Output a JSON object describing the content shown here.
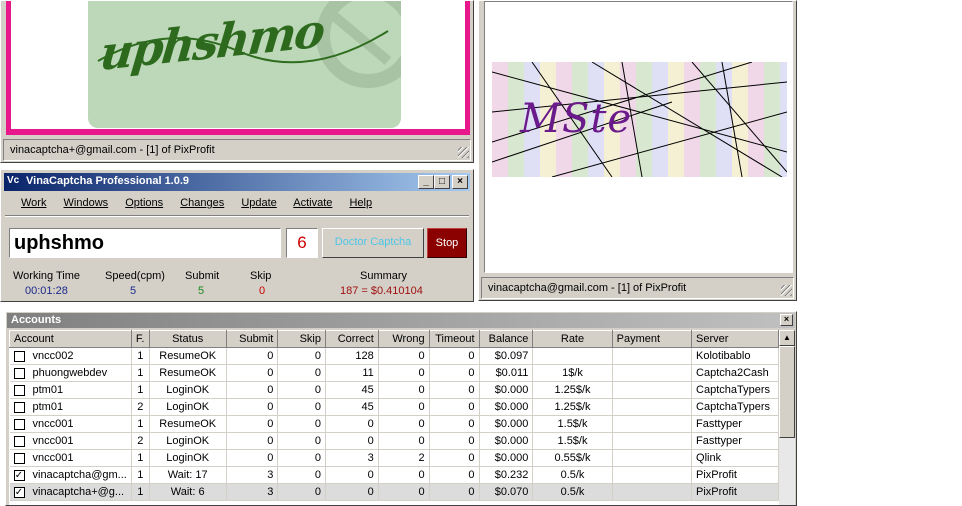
{
  "top_left": {
    "status": "vinacaptcha+@gmail.com - [1] of PixProfit",
    "captcha_text": "uphshmo"
  },
  "top_right": {
    "status": "vinacaptcha@gmail.com - [1] of PixProfit",
    "captcha_text": "MSte"
  },
  "app": {
    "title": "VinaCaptcha Professional 1.0.9",
    "icon_text": "Vc",
    "menu": [
      "Work",
      "Windows",
      "Options",
      "Changes",
      "Update",
      "Activate",
      "Help"
    ],
    "input_value": "uphshmo",
    "counter": "6",
    "doctor_button": "Doctor Captcha",
    "stop_button": "Stop",
    "stats": {
      "working_time_label": "Working Time",
      "working_time": "00:01:28",
      "speed_label": "Speed(cpm)",
      "speed": "5",
      "submit_label": "Submit",
      "submit": "5",
      "skip_label": "Skip",
      "skip": "0",
      "summary_label": "Summary",
      "summary": "187 = $0.410104"
    }
  },
  "accounts": {
    "title": "Accounts",
    "columns": [
      "Account",
      "F.",
      "Status",
      "Submit",
      "Skip",
      "Correct",
      "Wrong",
      "Timeout",
      "Balance",
      "Rate",
      "Payment",
      "Server"
    ],
    "rows": [
      {
        "checked": false,
        "account": "vncc002",
        "f": "1",
        "status": "ResumeOK",
        "submit": "0",
        "skip": "0",
        "correct": "128",
        "wrong": "0",
        "timeout": "0",
        "balance": "$0.097",
        "rate": "",
        "payment": "",
        "server": "Kolotibablo"
      },
      {
        "checked": false,
        "account": "phuongwebdev",
        "f": "1",
        "status": "ResumeOK",
        "submit": "0",
        "skip": "0",
        "correct": "11",
        "wrong": "0",
        "timeout": "0",
        "balance": "$0.011",
        "rate": "1$/k",
        "payment": "",
        "server": "Captcha2Cash"
      },
      {
        "checked": false,
        "account": "ptm01",
        "f": "1",
        "status": "LoginOK",
        "submit": "0",
        "skip": "0",
        "correct": "45",
        "wrong": "0",
        "timeout": "0",
        "balance": "$0.000",
        "rate": "1.25$/k",
        "payment": "",
        "server": "CaptchaTypers"
      },
      {
        "checked": false,
        "account": "ptm01",
        "f": "2",
        "status": "LoginOK",
        "submit": "0",
        "skip": "0",
        "correct": "45",
        "wrong": "0",
        "timeout": "0",
        "balance": "$0.000",
        "rate": "1.25$/k",
        "payment": "",
        "server": "CaptchaTypers"
      },
      {
        "checked": false,
        "account": "vncc001",
        "f": "1",
        "status": "ResumeOK",
        "submit": "0",
        "skip": "0",
        "correct": "0",
        "wrong": "0",
        "timeout": "0",
        "balance": "$0.000",
        "rate": "1.5$/k",
        "payment": "",
        "server": "Fasttyper"
      },
      {
        "checked": false,
        "account": "vncc001",
        "f": "2",
        "status": "LoginOK",
        "submit": "0",
        "skip": "0",
        "correct": "0",
        "wrong": "0",
        "timeout": "0",
        "balance": "$0.000",
        "rate": "1.5$/k",
        "payment": "",
        "server": "Fasttyper"
      },
      {
        "checked": false,
        "account": "vncc001",
        "f": "1",
        "status": "LoginOK",
        "submit": "0",
        "skip": "0",
        "correct": "3",
        "wrong": "2",
        "timeout": "0",
        "balance": "$0.000",
        "rate": "0.55$/k",
        "payment": "",
        "server": "Qlink"
      },
      {
        "checked": true,
        "account": "vinacaptcha@gm...",
        "f": "1",
        "status": "Wait: 17",
        "submit": "3",
        "skip": "0",
        "correct": "0",
        "wrong": "0",
        "timeout": "0",
        "balance": "$0.232",
        "rate": "0.5/k",
        "payment": "",
        "server": "PixProfit"
      },
      {
        "checked": true,
        "account": "vinacaptcha+@g...",
        "f": "1",
        "status": "Wait: 6",
        "submit": "3",
        "skip": "0",
        "correct": "0",
        "wrong": "0",
        "timeout": "0",
        "balance": "$0.070",
        "rate": "0.5/k",
        "payment": "",
        "server": "PixProfit"
      }
    ]
  },
  "colors": {
    "pink_frame": "#e8188c",
    "titlebar": "#0a246a",
    "stop_bg": "#8b0000",
    "counter": "#cc0000"
  }
}
